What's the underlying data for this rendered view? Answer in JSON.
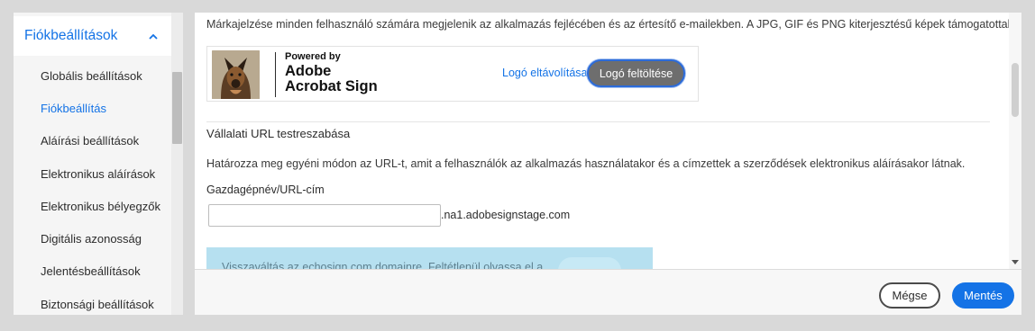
{
  "sidebar": {
    "header": "Fiókbeállítások",
    "items": [
      {
        "label": "Globális beállítások",
        "active": false
      },
      {
        "label": "Fiókbeállítás",
        "active": true
      },
      {
        "label": "Aláírási beállítások",
        "active": false
      },
      {
        "label": "Elektronikus aláírások",
        "active": false
      },
      {
        "label": "Elektronikus bélyegzők",
        "active": false
      },
      {
        "label": "Digitális azonosság",
        "active": false
      },
      {
        "label": "Jelentésbeállítások",
        "active": false
      },
      {
        "label": "Biztonsági beállítások",
        "active": false
      }
    ]
  },
  "main": {
    "branding_description": "Márkajelzése minden felhasználó számára megjelenik az alkalmazás fejlécében és az értesítő e-mailekben. A JPG, GIF és PNG kiterjesztésű képek támogatottak.",
    "brand": {
      "powered_by": "Powered by",
      "line1": "Adobe",
      "line2": "Acrobat Sign"
    },
    "remove_logo_label": "Logó eltávolítása",
    "upload_logo_label": "Logó feltöltése",
    "url_section_title": "Vállalati URL testreszabása",
    "url_section_description": "Határozza meg egyéni módon az URL-t, amit a felhasználók az alkalmazás használatakor és a címzettek a szerződések elektronikus aláírásakor látnak.",
    "hostname_label": "Gazdagépnév/URL-cím",
    "hostname_value": "",
    "url_suffix": ".na1.adobesignstage.com",
    "info_text": "Visszaváltás az echosign.com domainre. Feltétlenül olvassa el a"
  },
  "footer": {
    "cancel_label": "Mégse",
    "save_label": "Mentés"
  },
  "colors": {
    "accent": "#1473e6",
    "info_background": "#b6e0f0",
    "upload_button": "#6e6e6e"
  },
  "icons": {
    "sidebar_toggle": "chevron-up-icon",
    "scroll_down": "triangle-down-icon"
  }
}
